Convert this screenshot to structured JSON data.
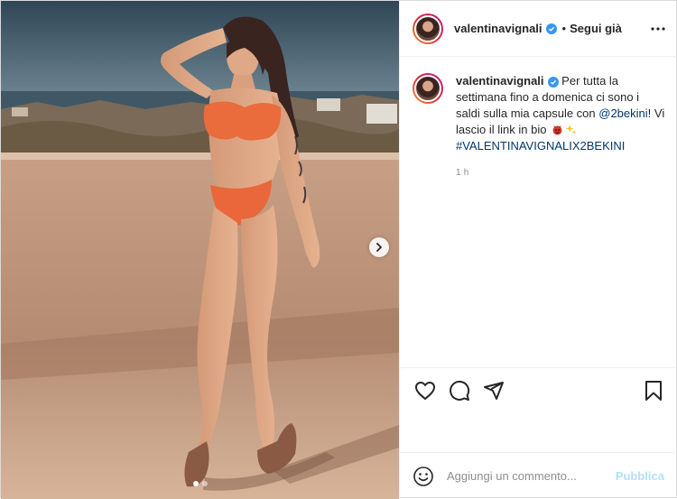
{
  "post": {
    "username": "valentinavignali",
    "separator": "•",
    "follow_label": "Segui già",
    "media_alt": "Donna in bikini arancione su una terrazza al sole",
    "carousel": {
      "total": 2,
      "active_index": 0
    }
  },
  "caption": {
    "username": "valentinavignali",
    "text_1": "Per tutta la settimana fino a domenica ci sono i saldi sulla mia capsule con ",
    "mention": "@2bekini",
    "text_2": "! Vi lascio il link in bio",
    "hashtag": "#VALENTINAVIGNALIX2BEKINI",
    "time": "1 h"
  },
  "comment_box": {
    "placeholder": "Aggiungi un commento...",
    "post_label": "Pubblica"
  },
  "colors": {
    "link": "#00376b",
    "verified": "#3897f0",
    "publish_disabled": "#b2dffc",
    "meta_text": "#8e8e8e"
  },
  "icons": {
    "more": "more-icon",
    "like": "heart-icon",
    "comment": "comment-icon",
    "share": "share-icon",
    "save": "bookmark-icon",
    "emoji": "smile-icon",
    "next": "chevron-right-icon"
  }
}
